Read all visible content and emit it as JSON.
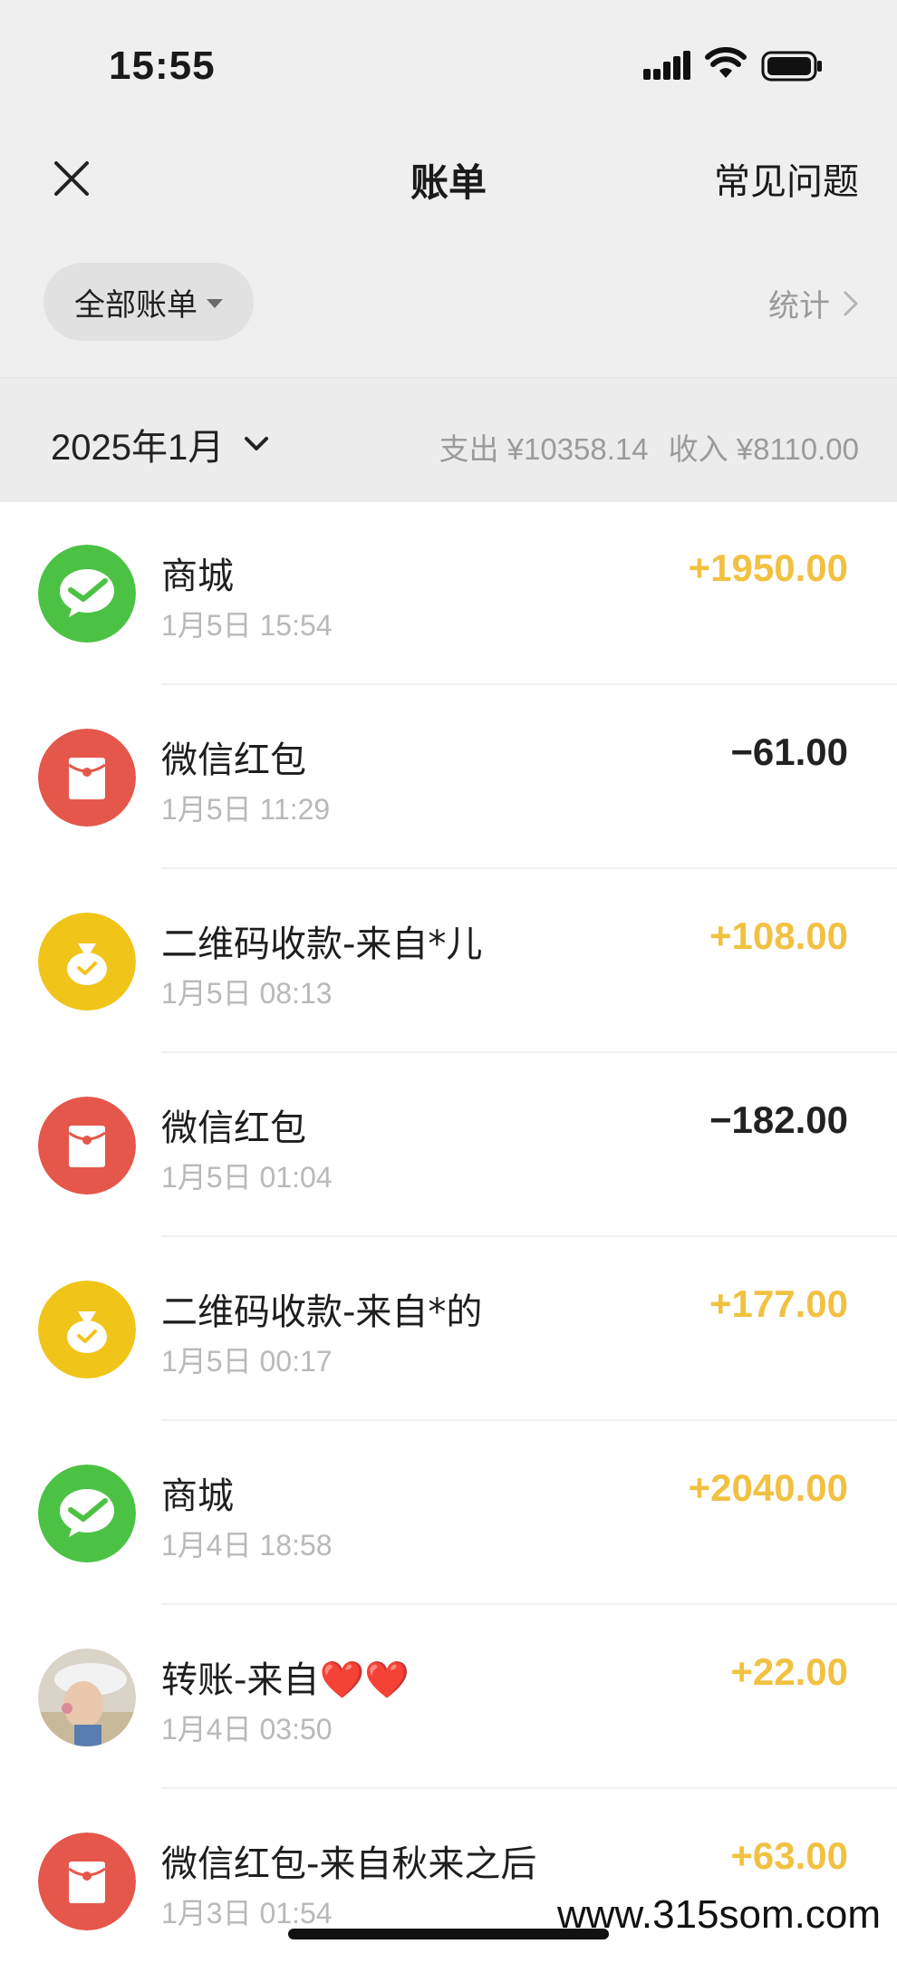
{
  "status_bar": {
    "time": "15:55"
  },
  "nav": {
    "title": "账单",
    "faq": "常见问题"
  },
  "filter": {
    "label": "全部账单",
    "stats": "统计"
  },
  "month": {
    "label": "2025年1月",
    "expense": "支出 ¥10358.14",
    "income": "收入 ¥8110.00"
  },
  "transactions": [
    {
      "name": "商城",
      "time": "1月5日 15:54",
      "amount": "+1950.00",
      "type": "wechat"
    },
    {
      "name": "微信红包",
      "time": "1月5日 11:29",
      "amount": "−61.00",
      "type": "redpacket"
    },
    {
      "name": "二维码收款-来自*儿",
      "time": "1月5日 08:13",
      "amount": "+108.00",
      "type": "qrcode"
    },
    {
      "name": "微信红包",
      "time": "1月5日 01:04",
      "amount": "−182.00",
      "type": "redpacket"
    },
    {
      "name": "二维码收款-来自*的",
      "time": "1月5日 00:17",
      "amount": "+177.00",
      "type": "qrcode"
    },
    {
      "name": "商城",
      "time": "1月4日 18:58",
      "amount": "+2040.00",
      "type": "wechat"
    },
    {
      "name": "转账-来自",
      "name_suffix": "❤️❤️",
      "time": "1月4日 03:50",
      "amount": "+22.00",
      "type": "avatar"
    },
    {
      "name": "微信红包-来自秋来之后",
      "time": "1月3日 01:54",
      "amount": "+63.00",
      "type": "redpacket"
    }
  ],
  "watermark": "www.315som.com",
  "colors": {
    "income": "#f1c141",
    "wechat_green": "#4cc244",
    "red_packet": "#e5574b",
    "qr_yellow": "#f1c41a"
  }
}
